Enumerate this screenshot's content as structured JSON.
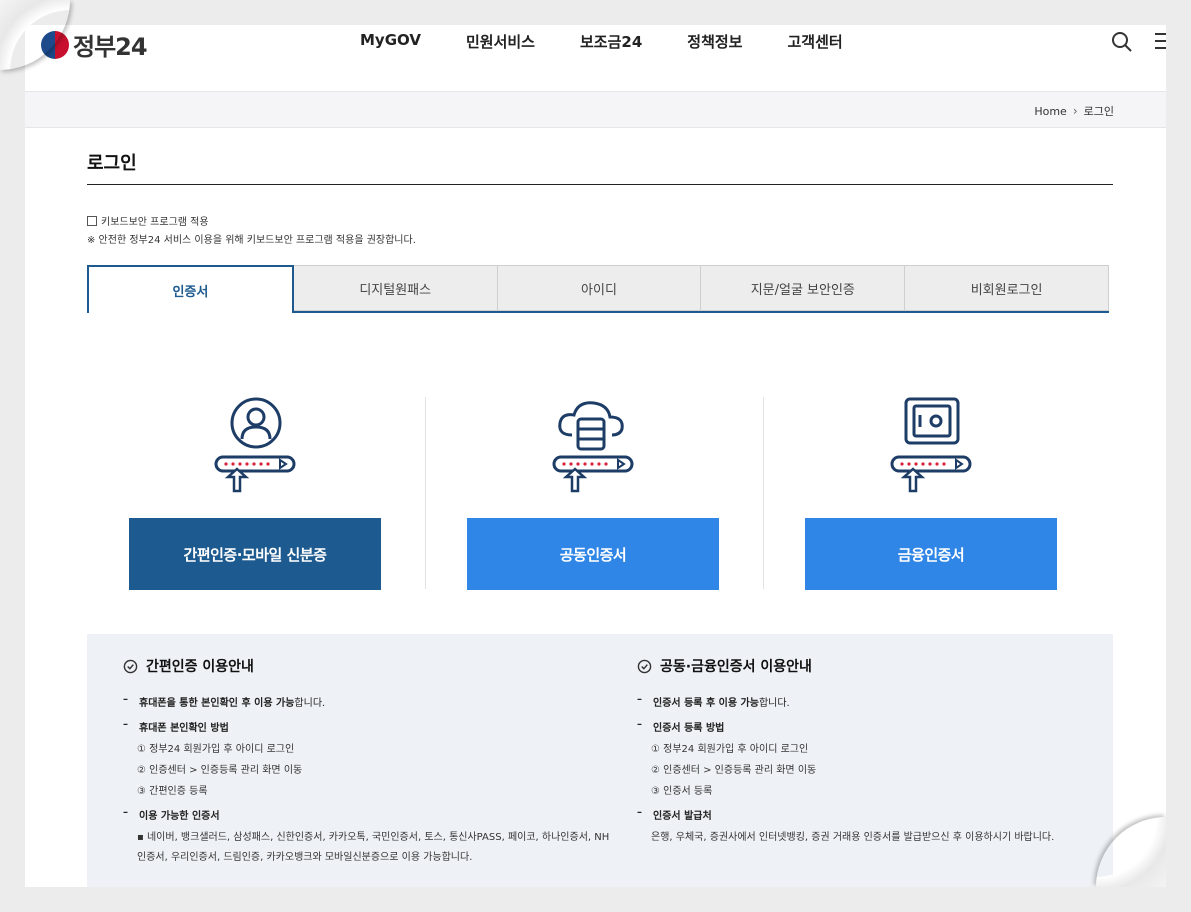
{
  "header": {
    "logo_text": "정부24",
    "nav": [
      "MyGOV",
      "민원서비스",
      "보조금24",
      "정책정보",
      "고객센터"
    ]
  },
  "breadcrumb": {
    "home": "Home",
    "current": "로그인"
  },
  "page": {
    "title": "로그인",
    "keyboard_security_label": "키보드보안 프로그램 적용",
    "keyboard_security_note": "※ 안전한 정부24 서비스 이용을 위해 키보드보안 프로그램 적용을 권장합니다."
  },
  "tabs": [
    {
      "label": "인증서",
      "active": true
    },
    {
      "label": "디지털원패스",
      "active": false
    },
    {
      "label": "아이디",
      "active": false
    },
    {
      "label": "지문/얼굴 보안인증",
      "active": false
    },
    {
      "label": "비회원로그인",
      "active": false
    }
  ],
  "login_options": [
    {
      "label": "간편인증·모바일 신분증",
      "icon": "user-icon"
    },
    {
      "label": "공동인증서",
      "icon": "cloud-server-icon"
    },
    {
      "label": "금융인증서",
      "icon": "safe-icon"
    }
  ],
  "colors": {
    "primary_dark": "#1d5a8f",
    "primary_blue": "#2f86e6",
    "guide_bg": "#eef2f6"
  },
  "guide_left": {
    "title": "간편인증 이용안내",
    "item1_bold": "휴대폰을 통한 본인확인 후 이용 가능",
    "item1_rest": "합니다.",
    "item2": "휴대폰 본인확인 방법",
    "step1": "① 정부24 회원가입 후 아이디 로그인",
    "step2": "② 인증센터 > 인증등록 관리 화면 이동",
    "step3": "③ 간편인증 등록",
    "item3": "이용 가능한 인증서",
    "bullet": "네이버, 뱅크샐러드, 삼성패스, 신한인증서, 카카오톡, 국민인증서, 토스, 통신사PASS, 페이코, 하나인증서, NH인증서, 우리인증서, 드림인증, 카카오뱅크와 모바일신분증으로 이용 가능합니다."
  },
  "guide_right": {
    "title": "공동·금융인증서 이용안내",
    "item1_bold": "인증서 등록 후 이용 가능",
    "item1_rest": "합니다.",
    "item2": "인증서 등록 방법",
    "step1": "① 정부24 회원가입 후 아이디 로그인",
    "step2": "② 인증센터 > 인증등록 관리 화면 이동",
    "step3": "③ 인증서 등록",
    "item3": "인증서 발급처",
    "desc": "은행, 우체국, 증권사에서 인터넷뱅킹, 증권 거래용 인증서를 발급받으신 후 이용하시기 바랍니다."
  }
}
